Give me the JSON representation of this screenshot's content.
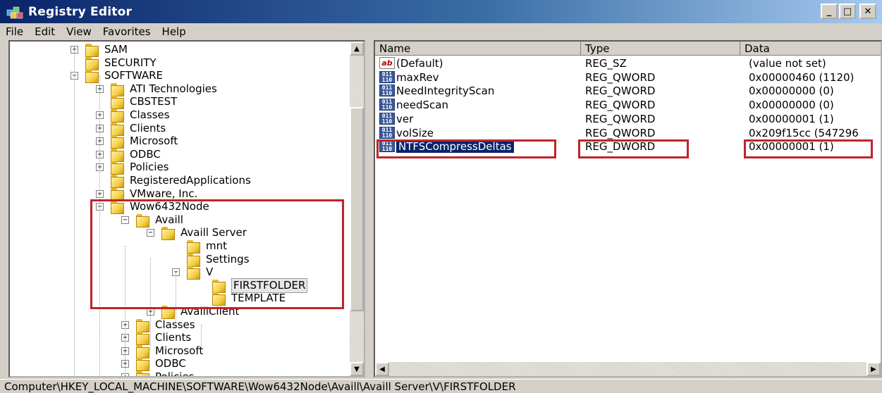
{
  "window": {
    "title": "Registry Editor",
    "buttons": {
      "minimize": "_",
      "maximize": "□",
      "close": "✕"
    }
  },
  "menu": [
    "File",
    "Edit",
    "View",
    "Favorites",
    "Help"
  ],
  "tree": [
    {
      "label": "SAM",
      "expander": "+",
      "level": 0
    },
    {
      "label": "SECURITY",
      "expander": "",
      "level": 0
    },
    {
      "label": "SOFTWARE",
      "expander": "−",
      "level": 0
    },
    {
      "label": "ATI Technologies",
      "expander": "+",
      "level": 1
    },
    {
      "label": "CBSTEST",
      "expander": "",
      "level": 1
    },
    {
      "label": "Classes",
      "expander": "+",
      "level": 1
    },
    {
      "label": "Clients",
      "expander": "+",
      "level": 1
    },
    {
      "label": "Microsoft",
      "expander": "+",
      "level": 1
    },
    {
      "label": "ODBC",
      "expander": "+",
      "level": 1
    },
    {
      "label": "Policies",
      "expander": "+",
      "level": 1
    },
    {
      "label": "RegisteredApplications",
      "expander": "",
      "level": 1
    },
    {
      "label": "VMware, Inc.",
      "expander": "+",
      "level": 1
    },
    {
      "label": "Wow6432Node",
      "expander": "−",
      "level": 1
    },
    {
      "label": "Availl",
      "expander": "−",
      "level": 2
    },
    {
      "label": "Availl Server",
      "expander": "−",
      "level": 3
    },
    {
      "label": "mnt",
      "expander": "",
      "level": 4
    },
    {
      "label": "Settings",
      "expander": "",
      "level": 4
    },
    {
      "label": "V",
      "expander": "−",
      "level": 4
    },
    {
      "label": "FIRSTFOLDER",
      "expander": "",
      "level": 5,
      "selected": true
    },
    {
      "label": "TEMPLATE",
      "expander": "",
      "level": 5
    },
    {
      "label": "AvaillClient",
      "expander": "+",
      "level": 3
    },
    {
      "label": "Classes",
      "expander": "+",
      "level": 2
    },
    {
      "label": "Clients",
      "expander": "+",
      "level": 2
    },
    {
      "label": "Microsoft",
      "expander": "+",
      "level": 2
    },
    {
      "label": "ODBC",
      "expander": "+",
      "level": 2
    },
    {
      "label": "Policies",
      "expander": "+",
      "level": 2
    }
  ],
  "columns": [
    "Name",
    "Type",
    "Data"
  ],
  "values": [
    {
      "name": "(Default)",
      "type": "REG_SZ",
      "data": "(value not set)",
      "icon": "ab"
    },
    {
      "name": "maxRev",
      "type": "REG_QWORD",
      "data": "0x00000460 (1120)",
      "icon": "bin"
    },
    {
      "name": "NeedIntegrityScan",
      "type": "REG_QWORD",
      "data": "0x00000000 (0)",
      "icon": "bin"
    },
    {
      "name": "needScan",
      "type": "REG_QWORD",
      "data": "0x00000000 (0)",
      "icon": "bin"
    },
    {
      "name": "ver",
      "type": "REG_QWORD",
      "data": "0x00000001 (1)",
      "icon": "bin"
    },
    {
      "name": "volSize",
      "type": "REG_QWORD",
      "data": "0x209f15cc (547296",
      "icon": "bin"
    },
    {
      "name": "NTFSCompressDeltas",
      "type": "REG_DWORD",
      "data": "0x00000001 (1)",
      "icon": "bin",
      "selected": true
    }
  ],
  "icon_labels": {
    "ab": "ab",
    "bin": "011\n110"
  },
  "status": "Computer\\HKEY_LOCAL_MACHINE\\SOFTWARE\\Wow6432Node\\Availl\\Availl Server\\V\\FIRSTFOLDER",
  "colors": {
    "highlight_box": "#c0242b",
    "selection": "#0a246a",
    "title_bar": "#0a246a"
  }
}
